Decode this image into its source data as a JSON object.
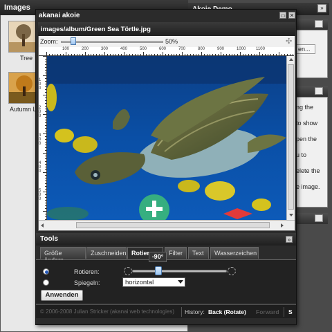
{
  "images_panel": {
    "title": "Images",
    "items": [
      {
        "label": "Tree"
      },
      {
        "label": "Autumn L"
      }
    ]
  },
  "demo_panel": {
    "title": "Akoie Demo",
    "text_button": "en...",
    "help_lines": [
      "ng the",
      "to show",
      "pen the",
      "u to",
      "elete the",
      "e image."
    ]
  },
  "dialog": {
    "title": "akanai akoie",
    "image_path": "images/album/Green Sea Törtle.jpg",
    "zoom_label": "Zoom:",
    "zoom_value": "50%",
    "zoom_fraction": 0.12,
    "ruler_top": [
      "100",
      "200",
      "300",
      "400",
      "500",
      "600",
      "700",
      "800",
      "900",
      "1000",
      "1100"
    ],
    "ruler_left": [
      "100",
      "200",
      "300",
      "400",
      "500"
    ]
  },
  "tools": {
    "title": "Tools",
    "tabs": [
      "Größe ändern",
      "Zuschneiden",
      "Rotieren",
      "Filter",
      "Text",
      "Wasserzeichen"
    ],
    "active_tab": "Rotieren",
    "rotate_label": "Rotieren:",
    "mirror_label": "Spiegeln:",
    "rotate_value": "-90°",
    "mirror_value": "horizontal",
    "apply_label": "Anwenden"
  },
  "status": {
    "copyright": "© 2006-2008 Julian Stricker (akanai web technologies)",
    "history_label": "History:",
    "back": "Back (Rotate)",
    "forward": "Forward",
    "extra": "S"
  }
}
